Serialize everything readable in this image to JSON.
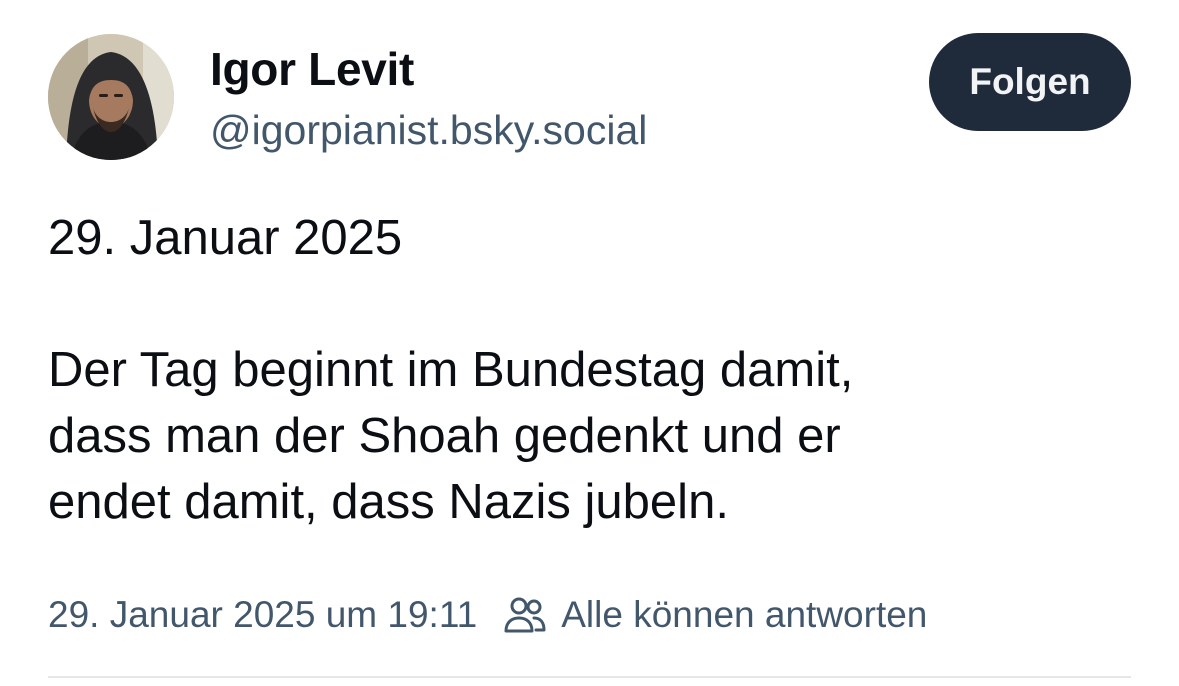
{
  "author": {
    "display_name": "Igor Levit",
    "handle": "@igorpianist.bsky.social",
    "avatar_icon": "profile-photo"
  },
  "follow_button": {
    "label": "Folgen",
    "background": "#1f2a3a",
    "text_color": "#f1f3f5"
  },
  "post": {
    "lines": [
      "29. Januar 2025",
      "Der Tag beginnt im Bundestag damit,",
      "dass man der Shoah gedenkt und er",
      "endet damit, dass Nazis jubeln."
    ]
  },
  "meta": {
    "timestamp": "29. Januar 2025 um 19:11",
    "reply_setting_icon": "people-icon",
    "reply_setting_label": "Alle können antworten"
  },
  "colors": {
    "text_primary": "#0b0f14",
    "text_secondary": "#42576c",
    "divider": "#e3e7eb"
  }
}
